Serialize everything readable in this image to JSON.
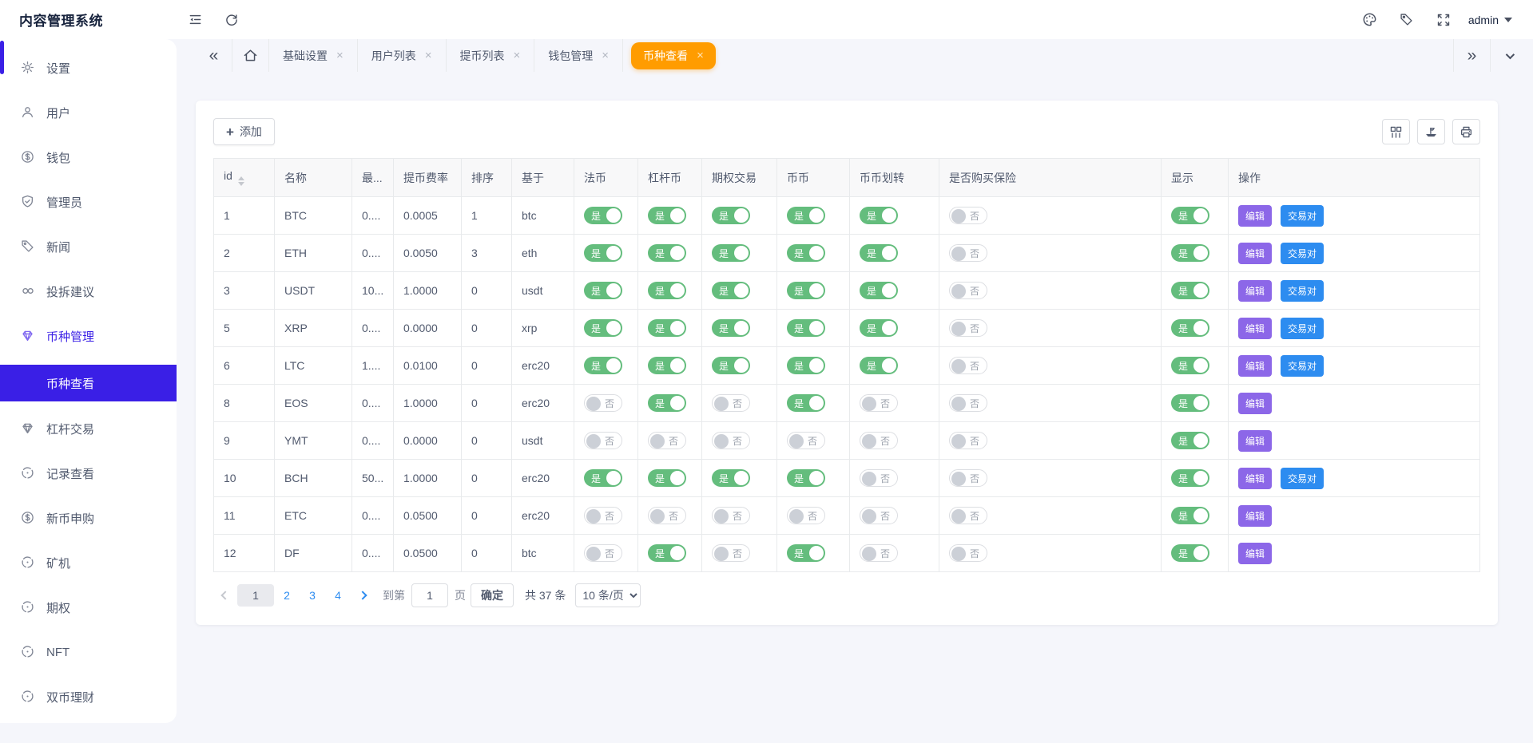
{
  "app": {
    "title": "内容管理系统"
  },
  "header": {
    "user": "admin",
    "icons": [
      "menu-collapse-icon",
      "refresh-icon",
      "palette-icon",
      "tag-icon",
      "fullscreen-icon"
    ]
  },
  "tabbar": {
    "tabs": [
      {
        "key": "base-settings",
        "label": "基础设置",
        "active": false
      },
      {
        "key": "user-list",
        "label": "用户列表",
        "active": false
      },
      {
        "key": "withdraw-list",
        "label": "提币列表",
        "active": false
      },
      {
        "key": "wallet-manage",
        "label": "钱包管理",
        "active": false
      },
      {
        "key": "coin-view",
        "label": "币种查看",
        "active": true
      }
    ]
  },
  "sidebar": {
    "items": [
      {
        "key": "settings",
        "label": "设置",
        "icon": "gear-icon",
        "active": false
      },
      {
        "key": "users",
        "label": "用户",
        "icon": "user-icon",
        "active": false
      },
      {
        "key": "wallet",
        "label": "钱包",
        "icon": "dollar-circle-icon",
        "active": false
      },
      {
        "key": "admins",
        "label": "管理员",
        "icon": "shield-check-icon",
        "active": false
      },
      {
        "key": "news",
        "label": "新闻",
        "icon": "tag-icon",
        "active": false
      },
      {
        "key": "feedback",
        "label": "投拆建议",
        "icon": "link-icon",
        "active": false
      },
      {
        "key": "coin-manage",
        "label": "币种管理",
        "icon": "gem-icon",
        "active": true,
        "children": [
          {
            "key": "coin-view",
            "label": "币种查看",
            "active": true
          }
        ]
      },
      {
        "key": "leverage-trade",
        "label": "杠杆交易",
        "icon": "gem-icon",
        "active": false
      },
      {
        "key": "record-view",
        "label": "记录查看",
        "icon": "coin-icon",
        "active": false
      },
      {
        "key": "new-coin",
        "label": "新币申购",
        "icon": "dollar-circle-icon",
        "active": false
      },
      {
        "key": "miner",
        "label": "矿机",
        "icon": "coin-icon",
        "active": false
      },
      {
        "key": "option",
        "label": "期权",
        "icon": "coin-icon",
        "active": false
      },
      {
        "key": "nft",
        "label": "NFT",
        "icon": "coin-icon",
        "active": false
      },
      {
        "key": "dual-finance",
        "label": "双币理财",
        "icon": "coin-icon",
        "active": false
      }
    ]
  },
  "toolbar": {
    "add_label": "添加"
  },
  "table": {
    "toggle_on_label": "是",
    "toggle_off_label": "否",
    "op_labels": {
      "edit": "编辑",
      "pair": "交易对"
    },
    "columns": [
      {
        "key": "id",
        "label": "id",
        "type": "text",
        "sortable": true
      },
      {
        "key": "name",
        "label": "名称",
        "type": "text"
      },
      {
        "key": "max",
        "label": "最...",
        "type": "text"
      },
      {
        "key": "fee",
        "label": "提币费率",
        "type": "text"
      },
      {
        "key": "sort",
        "label": "排序",
        "type": "text"
      },
      {
        "key": "base",
        "label": "基于",
        "type": "text"
      },
      {
        "key": "fabi",
        "label": "法币",
        "type": "toggle"
      },
      {
        "key": "leverage",
        "label": "杠杆币",
        "type": "toggle"
      },
      {
        "key": "option",
        "label": "期权交易",
        "type": "toggle"
      },
      {
        "key": "bibi",
        "label": "币币",
        "type": "toggle"
      },
      {
        "key": "transfer",
        "label": "币币划转",
        "type": "toggle"
      },
      {
        "key": "insurance",
        "label": "是否购买保险",
        "type": "toggle"
      },
      {
        "key": "show",
        "label": "显示",
        "type": "toggle"
      },
      {
        "key": "ops",
        "label": "操作",
        "type": "ops"
      }
    ],
    "rows": [
      {
        "id": "1",
        "name": "BTC",
        "max": "0....",
        "fee": "0.0005",
        "sort": "1",
        "base": "btc",
        "fabi": true,
        "leverage": true,
        "option": true,
        "bibi": true,
        "transfer": true,
        "insurance": false,
        "show": true,
        "ops": [
          "edit",
          "pair"
        ]
      },
      {
        "id": "2",
        "name": "ETH",
        "max": "0....",
        "fee": "0.0050",
        "sort": "3",
        "base": "eth",
        "fabi": true,
        "leverage": true,
        "option": true,
        "bibi": true,
        "transfer": true,
        "insurance": false,
        "show": true,
        "ops": [
          "edit",
          "pair"
        ]
      },
      {
        "id": "3",
        "name": "USDT",
        "max": "10...",
        "fee": "1.0000",
        "sort": "0",
        "base": "usdt",
        "fabi": true,
        "leverage": true,
        "option": true,
        "bibi": true,
        "transfer": true,
        "insurance": false,
        "show": true,
        "ops": [
          "edit",
          "pair"
        ]
      },
      {
        "id": "5",
        "name": "XRP",
        "max": "0....",
        "fee": "0.0000",
        "sort": "0",
        "base": "xrp",
        "fabi": true,
        "leverage": true,
        "option": true,
        "bibi": true,
        "transfer": true,
        "insurance": false,
        "show": true,
        "ops": [
          "edit",
          "pair"
        ]
      },
      {
        "id": "6",
        "name": "LTC",
        "max": "1....",
        "fee": "0.0100",
        "sort": "0",
        "base": "erc20",
        "fabi": true,
        "leverage": true,
        "option": true,
        "bibi": true,
        "transfer": true,
        "insurance": false,
        "show": true,
        "ops": [
          "edit",
          "pair"
        ]
      },
      {
        "id": "8",
        "name": "EOS",
        "max": "0....",
        "fee": "1.0000",
        "sort": "0",
        "base": "erc20",
        "fabi": false,
        "leverage": true,
        "option": false,
        "bibi": true,
        "transfer": false,
        "insurance": false,
        "show": true,
        "ops": [
          "edit"
        ]
      },
      {
        "id": "9",
        "name": "YMT",
        "max": "0....",
        "fee": "0.0000",
        "sort": "0",
        "base": "usdt",
        "fabi": false,
        "leverage": false,
        "option": false,
        "bibi": false,
        "transfer": false,
        "insurance": false,
        "show": true,
        "ops": [
          "edit"
        ]
      },
      {
        "id": "10",
        "name": "BCH",
        "max": "50...",
        "fee": "1.0000",
        "sort": "0",
        "base": "erc20",
        "fabi": true,
        "leverage": true,
        "option": true,
        "bibi": true,
        "transfer": false,
        "insurance": false,
        "show": true,
        "ops": [
          "edit",
          "pair"
        ]
      },
      {
        "id": "11",
        "name": "ETC",
        "max": "0....",
        "fee": "0.0500",
        "sort": "0",
        "base": "erc20",
        "fabi": false,
        "leverage": false,
        "option": false,
        "bibi": false,
        "transfer": false,
        "insurance": false,
        "show": true,
        "ops": [
          "edit"
        ]
      },
      {
        "id": "12",
        "name": "DF",
        "max": "0....",
        "fee": "0.0500",
        "sort": "0",
        "base": "btc",
        "fabi": false,
        "leverage": true,
        "option": false,
        "bibi": true,
        "transfer": false,
        "insurance": false,
        "show": true,
        "ops": [
          "edit"
        ]
      }
    ]
  },
  "pagination": {
    "pages": [
      "1",
      "2",
      "3",
      "4"
    ],
    "current": "1",
    "goto_prefix": "到第",
    "goto_value": "1",
    "goto_suffix": "页",
    "confirm_label": "确定",
    "total_label": "共 37 条",
    "page_size_label": "10 条/页"
  },
  "colors": {
    "accent_orange": "#ff9c00",
    "active_blue": "#3a1fe6",
    "toggle_green": "#64bd7d",
    "edit_purple": "#8c67e8",
    "pair_blue": "#2d8cf0"
  }
}
